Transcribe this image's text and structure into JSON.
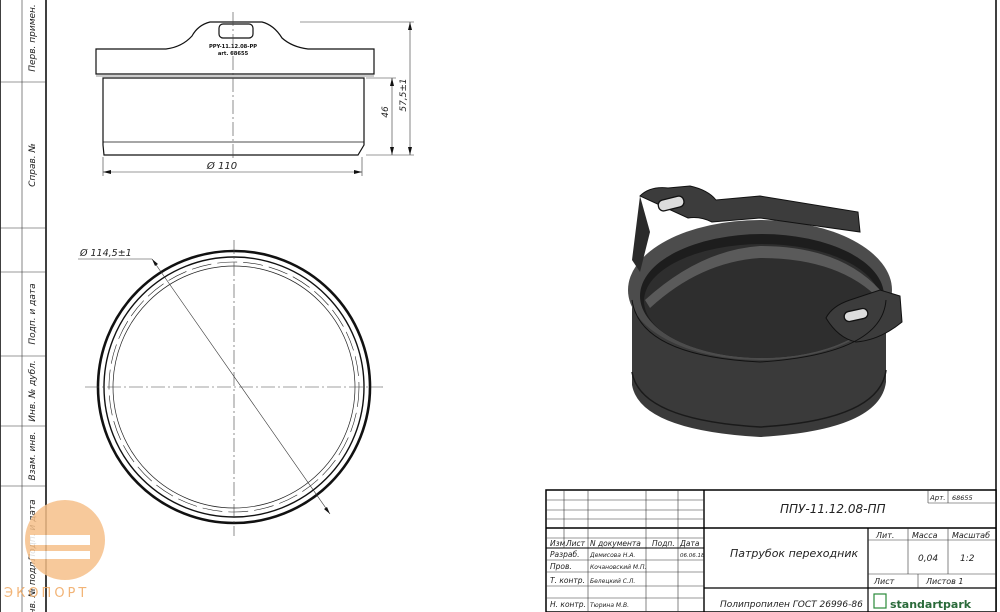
{
  "side_stamp": {
    "perv_primen": "Перв. примен.",
    "sprav_no": "Справ. №",
    "podp_data_1": "Подп. и дата",
    "inv_dubl": "Инв. № дубл.",
    "vzam_inv": "Взам. инв.",
    "podp_data_2": "Подп. и дата",
    "inv_podl": "Инв. № подл."
  },
  "front_view": {
    "tag_line1": "PPY-11.12.08-PP",
    "tag_line2": "art. 68655",
    "dim_width": "Ø 110",
    "dim_inner_height": "46",
    "dim_total_height": "57,5±1"
  },
  "top_view": {
    "dim_diameter": "Ø 114,5±1"
  },
  "title_block": {
    "designation": "ППУ-11.12.08-ПП",
    "art_label": "Арт.",
    "art_value": "68655",
    "name": "Патрубок переходник",
    "material": "Полипропилен ГОСТ 26996-86",
    "lit_label": "Лит.",
    "mass_label": "Масса",
    "mass_value": "0,04",
    "scale_label": "Масштаб",
    "scale_value": "1:2",
    "sheet_label": "Лист",
    "sheets_label": "Листов 1",
    "col_izm": "Изм.",
    "col_list": "Лист",
    "col_doc": "N документа",
    "col_podp": "Подп.",
    "col_date": "Дата",
    "row_razrab": "Разраб.",
    "row_prov": "Пров.",
    "row_tkontr": "Т. контр.",
    "row_nkontr": "Н. контр.",
    "name_razrab": "Демисова Н.А.",
    "name_prov": "Кочановский М.П.",
    "name_tkontr": "Белецкий С.Л.",
    "name_nkontr": "Тюрина М.В.",
    "date_razrab": "06.06.18",
    "company": "standartpark"
  },
  "watermark": {
    "text": "ЭКОПОРТ",
    "accent_color": "#f0a860"
  }
}
